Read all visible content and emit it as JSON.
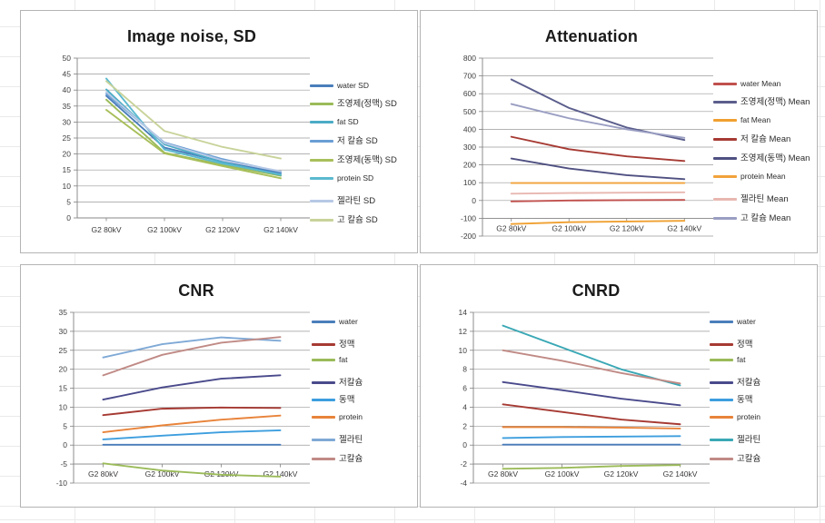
{
  "meta": {
    "app": "spreadsheet-chart-sheet",
    "background": "#ffffff",
    "gridline_color": "#d9d9d9"
  },
  "categories": [
    "G2 80kV",
    "G2 100kV",
    "G2 120kV",
    "G2 140kV"
  ],
  "charts": [
    {
      "id": "chart-1",
      "title": "Image noise, SD",
      "ylim": [
        0,
        50
      ],
      "yticks": [
        0,
        5,
        10,
        15,
        20,
        25,
        30,
        35,
        40,
        45,
        50
      ],
      "legend_position": "right"
    },
    {
      "id": "chart-2",
      "title": "Attenuation",
      "ylim": [
        -200,
        800
      ],
      "yticks": [
        -200,
        -100,
        0,
        100,
        200,
        300,
        400,
        500,
        600,
        700,
        800
      ],
      "legend_position": "right"
    },
    {
      "id": "chart-3",
      "title": "CNR",
      "ylim": [
        -10,
        35
      ],
      "yticks": [
        -10,
        -5,
        0,
        5,
        10,
        15,
        20,
        25,
        30,
        35
      ],
      "legend_position": "right"
    },
    {
      "id": "chart-4",
      "title": "CNRD",
      "ylim": [
        -4,
        14
      ],
      "yticks": [
        -4,
        -2,
        0,
        2,
        4,
        6,
        8,
        10,
        12,
        14
      ],
      "legend_position": "right"
    }
  ],
  "chart_data": [
    {
      "type": "line",
      "title": "Image noise, SD",
      "xlabel": "",
      "ylabel": "",
      "ylim": [
        0,
        50
      ],
      "yticks": [
        0,
        5,
        10,
        15,
        20,
        25,
        30,
        35,
        40,
        45,
        50
      ],
      "grid": true,
      "legend": "right",
      "categories": [
        "G2 80kV",
        "G2 100kV",
        "G2 120kV",
        "G2 140kV"
      ],
      "series": [
        {
          "name": "water SD",
          "color": "#4a7ebb",
          "values": [
            38.2,
            22.0,
            17.6,
            14.0
          ]
        },
        {
          "name": "조영제(정맥) SD",
          "color": "#9bbb59",
          "values": [
            37.0,
            20.4,
            16.6,
            13.2
          ]
        },
        {
          "name": "fat SD",
          "color": "#4bacc6",
          "values": [
            40.2,
            23.0,
            17.4,
            13.4
          ]
        },
        {
          "name": "저 칼슘 SD",
          "color": "#6a9ed4",
          "values": [
            38.8,
            23.6,
            18.4,
            14.4
          ]
        },
        {
          "name": "조영제(동맥) SD",
          "color": "#a8bf5a",
          "values": [
            33.8,
            20.2,
            16.2,
            12.4
          ]
        },
        {
          "name": "protein SD",
          "color": "#5bb9cf",
          "values": [
            43.6,
            21.4,
            17.0,
            13.6
          ]
        },
        {
          "name": "젤라틴 SD",
          "color": "#b7c9e5",
          "values": [
            39.4,
            23.4,
            18.0,
            14.6
          ]
        },
        {
          "name": "고 칼슘 SD",
          "color": "#c8d39a",
          "values": [
            42.8,
            27.2,
            22.2,
            18.6
          ]
        }
      ]
    },
    {
      "type": "line",
      "title": "Attenuation",
      "xlabel": "",
      "ylabel": "",
      "ylim": [
        -200,
        800
      ],
      "yticks": [
        -200,
        -100,
        0,
        100,
        200,
        300,
        400,
        500,
        600,
        700,
        800
      ],
      "grid": true,
      "legend": "right",
      "categories": [
        "G2 80kV",
        "G2 100kV",
        "G2 120kV",
        "G2 140kV"
      ],
      "series": [
        {
          "name": "water Mean",
          "color": "#c0504d",
          "values": [
            -5,
            0,
            2,
            3
          ]
        },
        {
          "name": "조영제(정맥) Mean",
          "color": "#5b5e8c",
          "values": [
            680,
            520,
            410,
            340
          ]
        },
        {
          "name": "fat Mean",
          "color": "#f0a030",
          "values": [
            -132,
            -122,
            -118,
            -114
          ]
        },
        {
          "name": "저 칼슘 Mean",
          "color": "#a63a33",
          "values": [
            358,
            288,
            248,
            222
          ]
        },
        {
          "name": "조영제(동맥) Mean",
          "color": "#4f5081",
          "values": [
            236,
            180,
            142,
            120
          ]
        },
        {
          "name": "protein Mean",
          "color": "#f2a33c",
          "values": [
            98,
            98,
            98,
            98
          ]
        },
        {
          "name": "젤라틴 Mean",
          "color": "#e8b7b0",
          "values": [
            38,
            42,
            44,
            46
          ]
        },
        {
          "name": "고 칼슘 Mean",
          "color": "#9a9ec2",
          "values": [
            542,
            462,
            400,
            352
          ]
        }
      ]
    },
    {
      "type": "line",
      "title": "CNR",
      "xlabel": "",
      "ylabel": "",
      "ylim": [
        -10,
        35
      ],
      "yticks": [
        -10,
        -5,
        0,
        5,
        10,
        15,
        20,
        25,
        30,
        35
      ],
      "grid": true,
      "legend": "right",
      "categories": [
        "G2 80kV",
        "G2 100kV",
        "G2 120kV",
        "G2 140kV"
      ],
      "series": [
        {
          "name": "water",
          "color": "#4a7ebb",
          "values": [
            0.1,
            0.1,
            0.1,
            0.1
          ]
        },
        {
          "name": "정맥",
          "color": "#a63a33",
          "values": [
            7.9,
            9.6,
            9.9,
            9.8
          ]
        },
        {
          "name": "fat",
          "color": "#9bbb59",
          "values": [
            -4.8,
            -6.7,
            -7.8,
            -8.3
          ]
        },
        {
          "name": "저칼슘",
          "color": "#4a4a8c",
          "values": [
            12.0,
            15.2,
            17.5,
            18.4
          ]
        },
        {
          "name": "동맥",
          "color": "#3d9ede",
          "values": [
            1.5,
            2.5,
            3.4,
            3.9
          ]
        },
        {
          "name": "protein",
          "color": "#e8833a",
          "values": [
            3.4,
            5.2,
            6.7,
            7.8
          ]
        },
        {
          "name": "젤라틴",
          "color": "#7fa9d6",
          "values": [
            23.1,
            26.6,
            28.4,
            27.5
          ]
        },
        {
          "name": "고칼슘",
          "color": "#c08a85",
          "values": [
            18.4,
            23.8,
            27.0,
            28.5
          ]
        }
      ]
    },
    {
      "type": "line",
      "title": "CNRD",
      "xlabel": "",
      "ylabel": "",
      "ylim": [
        -4,
        14
      ],
      "yticks": [
        -4,
        -2,
        0,
        2,
        4,
        6,
        8,
        10,
        12,
        14
      ],
      "grid": true,
      "legend": "right",
      "categories": [
        "G2 80kV",
        "G2 100kV",
        "G2 120kV",
        "G2 140kV"
      ],
      "series": [
        {
          "name": "water",
          "color": "#4a7ebb",
          "values": [
            0.05,
            0.05,
            0.05,
            0.05
          ]
        },
        {
          "name": "정맥",
          "color": "#a63a33",
          "values": [
            4.3,
            3.5,
            2.7,
            2.2
          ]
        },
        {
          "name": "fat",
          "color": "#9bbb59",
          "values": [
            -2.5,
            -2.4,
            -2.2,
            -2.1
          ]
        },
        {
          "name": "저칼슘",
          "color": "#4a4a8c",
          "values": [
            6.65,
            5.8,
            4.9,
            4.2
          ]
        },
        {
          "name": "동맥",
          "color": "#3d9ede",
          "values": [
            0.75,
            0.85,
            0.9,
            0.95
          ]
        },
        {
          "name": "protein",
          "color": "#e8833a",
          "values": [
            1.9,
            1.9,
            1.85,
            1.75
          ]
        },
        {
          "name": "젤라틴",
          "color": "#3aa8b5",
          "values": [
            12.6,
            10.3,
            8.0,
            6.3
          ]
        },
        {
          "name": "고칼슘",
          "color": "#c08a85",
          "values": [
            10.0,
            8.9,
            7.6,
            6.5
          ]
        }
      ]
    }
  ]
}
